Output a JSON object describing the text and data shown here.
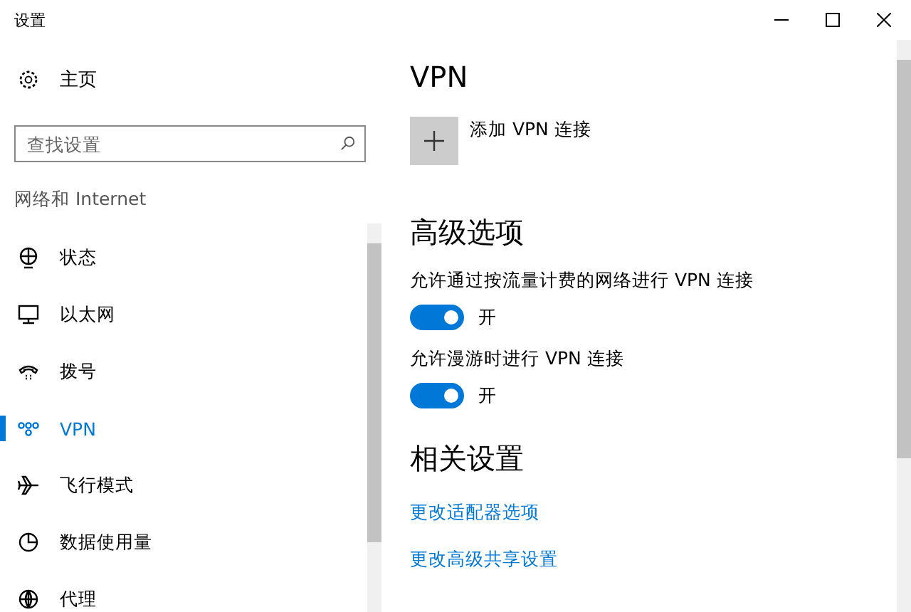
{
  "window": {
    "title": "设置"
  },
  "sidebar": {
    "home": "主页",
    "search": {
      "placeholder": "查找设置"
    },
    "section": "网络和 Internet",
    "items": [
      {
        "kind": "status",
        "label": "状态",
        "selected": false
      },
      {
        "kind": "ethernet",
        "label": "以太网",
        "selected": false
      },
      {
        "kind": "dialup",
        "label": "拨号",
        "selected": false
      },
      {
        "kind": "vpn",
        "label": "VPN",
        "selected": true
      },
      {
        "kind": "airplane",
        "label": "飞行模式",
        "selected": false
      },
      {
        "kind": "data",
        "label": "数据使用量",
        "selected": false
      },
      {
        "kind": "proxy",
        "label": "代理",
        "selected": false
      }
    ]
  },
  "main": {
    "title": "VPN",
    "add_label": "添加 VPN 连接",
    "advanced_title": "高级选项",
    "options": [
      {
        "label": "允许通过按流量计费的网络进行 VPN 连接",
        "on": true,
        "state_text": "开"
      },
      {
        "label": "允许漫游时进行 VPN 连接",
        "on": true,
        "state_text": "开"
      }
    ],
    "related_title": "相关设置",
    "links": [
      "更改适配器选项",
      "更改高级共享设置"
    ]
  }
}
